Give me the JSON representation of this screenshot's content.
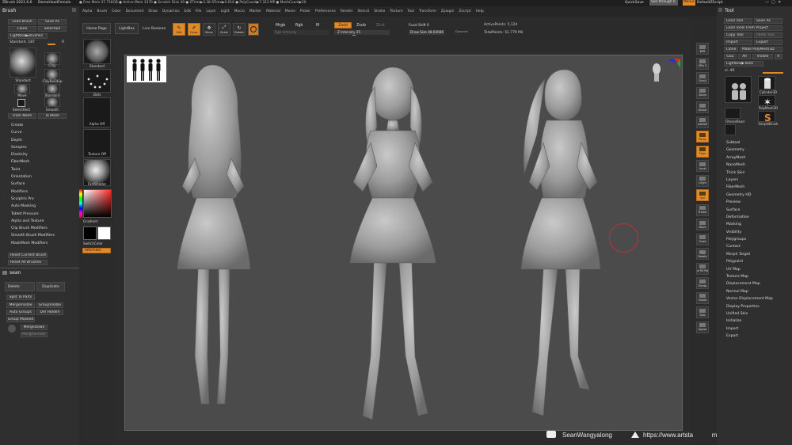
{
  "titlebar": {
    "app": "ZBrush 2021.6.6",
    "project": "DemoHeadFemale",
    "stats": "● Free Mem 37.716GB ● Active Mem 3370 ● Scratch Disk 49 ● ZTime▶3.38 ATime▶0.016 ● PolyCount▶7.323 MP ● MeshCount▶20",
    "quicksave": "QuickSave",
    "see_through": "See-through 0",
    "menus_btn": "Menus",
    "default_script": "DefaultZScript"
  },
  "menubar": [
    "Alpha",
    "Brush",
    "Color",
    "Document",
    "Draw",
    "Dynamics",
    "Edit",
    "File",
    "Layer",
    "Light",
    "Macro",
    "Marker",
    "Material",
    "Movie",
    "Picker",
    "Preferences",
    "Render",
    "Stencil",
    "Stroke",
    "Texture",
    "Tool",
    "Transform",
    "Zplugin",
    "Zscript",
    "Help"
  ],
  "brush_panel": {
    "title": "Brush",
    "buttons": [
      "Load Brush",
      "Save As",
      "Clone",
      "Selection",
      "Lightbox▶Brushes"
    ],
    "standard_label": "Standard. 187",
    "standard_value": "R",
    "brushes": [
      "Standard",
      "Clay",
      "ClayBuildup",
      "Move",
      "Standard",
      "SelectRect",
      "Smooth"
    ],
    "from_mesh": "From Mesh",
    "to_mesh": "To Mesh",
    "subpalettes": [
      "Create",
      "Curve",
      "Depth",
      "Samples",
      "Elasticity",
      "FiberMesh",
      "Twist",
      "Orientation",
      "Surface",
      "Modifiers",
      "Sculptris Pro",
      "Auto Masking",
      "Tablet Pressure",
      "Alpha and Texture",
      "Clip Brush Modifiers",
      "Smooth Brush Modifiers",
      "MaskMesh Modifiers"
    ],
    "reset_current": "Reset Current Brush",
    "reset_all": "Reset All Brushes"
  },
  "subtool_panel": {
    "title": "sean",
    "delete": "Delete",
    "duplicate": "Duplicate",
    "split_to_parts": "Split To Parts",
    "merge_visible": "MergeVisible",
    "group_visible": "GroupVisible",
    "auto_groups": "Auto Groups",
    "del_hidden": "Del Hidden",
    "group_masked": "Group Masked",
    "merge_down": "MergeDown",
    "merge_similar": "MergeSimilar"
  },
  "left_shelf": {
    "home_page": "Home Page",
    "lightbox": "LightBox",
    "live_boolean": "Live Boolean",
    "brush_label": "Standard",
    "stroke_label": "Dots",
    "alpha_label": "Alpha Off",
    "texture_label": "Texture Off",
    "material_label": "FastShader",
    "gradient_label": "Gradient",
    "switch_color": "SwitchColor",
    "alternate": "Alternate"
  },
  "top_shelf": {
    "edit": "Edit",
    "draw": "Draw",
    "move": "Move",
    "scale": "Scale",
    "rotate": "Rotate",
    "mrgb": "Mrgb",
    "rgb": "Rgb",
    "m": "M",
    "rgb_intensity": "Rgb Intensity",
    "zadd": "Zadd",
    "zsub": "Zsub",
    "zcut": "Zcut",
    "z_intensity": "Z Intensity 25",
    "focal_shift": "Focal Shift 0",
    "draw_size": "Draw Size 48.64680",
    "dynamic": "Dynamic",
    "active_points": "ActivePoints: 5,124",
    "total_points": "TotalPoints: 51.779 Mil"
  },
  "right_shelf": [
    "BPR",
    "SPix 3",
    "Scroll",
    "Zoom",
    "Actual",
    "AAHalf",
    "Persp",
    "Floor",
    "Local",
    "LSym",
    "Xyz",
    "Frame",
    "Move",
    "Scale",
    "Rotate",
    "Line Fill PolyF",
    "Transp",
    "Ghost",
    "Solo",
    "Xpose"
  ],
  "tool_panel": {
    "title": "Tool",
    "buttons": [
      "Load Tool",
      "Save As",
      "Load Tools From Project",
      "Copy Tool",
      "Paste Tool",
      "Import",
      "Export",
      "Clone",
      "Make PolyMesh3D",
      "GoZ",
      "All",
      "Visible",
      "R",
      "Lightbox▶Tools"
    ],
    "current_tool": "sl. 49",
    "tools": [
      "Cylinder3D",
      "PolyMesh3D",
      "FitnessRead",
      "SimpleBrush"
    ],
    "subpalettes": [
      "Subtool",
      "Geometry",
      "ArrayMesh",
      "NanoMesh",
      "Thick Skin",
      "Layers",
      "FiberMesh",
      "Geometry HD",
      "Preview",
      "Surface",
      "Deformation",
      "Masking",
      "Visibility",
      "Polygroups",
      "Contact",
      "Morph Target",
      "Polypaint",
      "UV Map",
      "Texture Map",
      "Displacement Map",
      "Normal Map",
      "Vector Displacement Map",
      "Display Properties",
      "Unified Skin",
      "Initialize",
      "Import",
      "Export"
    ]
  },
  "watermark": {
    "youtube": "SeanWangyalong",
    "artstation": "https://www.artstation.com/wangyalong"
  },
  "colors": {
    "accent": "#e08a2a",
    "panel": "#2f2f2f",
    "canvas": "#4b4b4b"
  }
}
